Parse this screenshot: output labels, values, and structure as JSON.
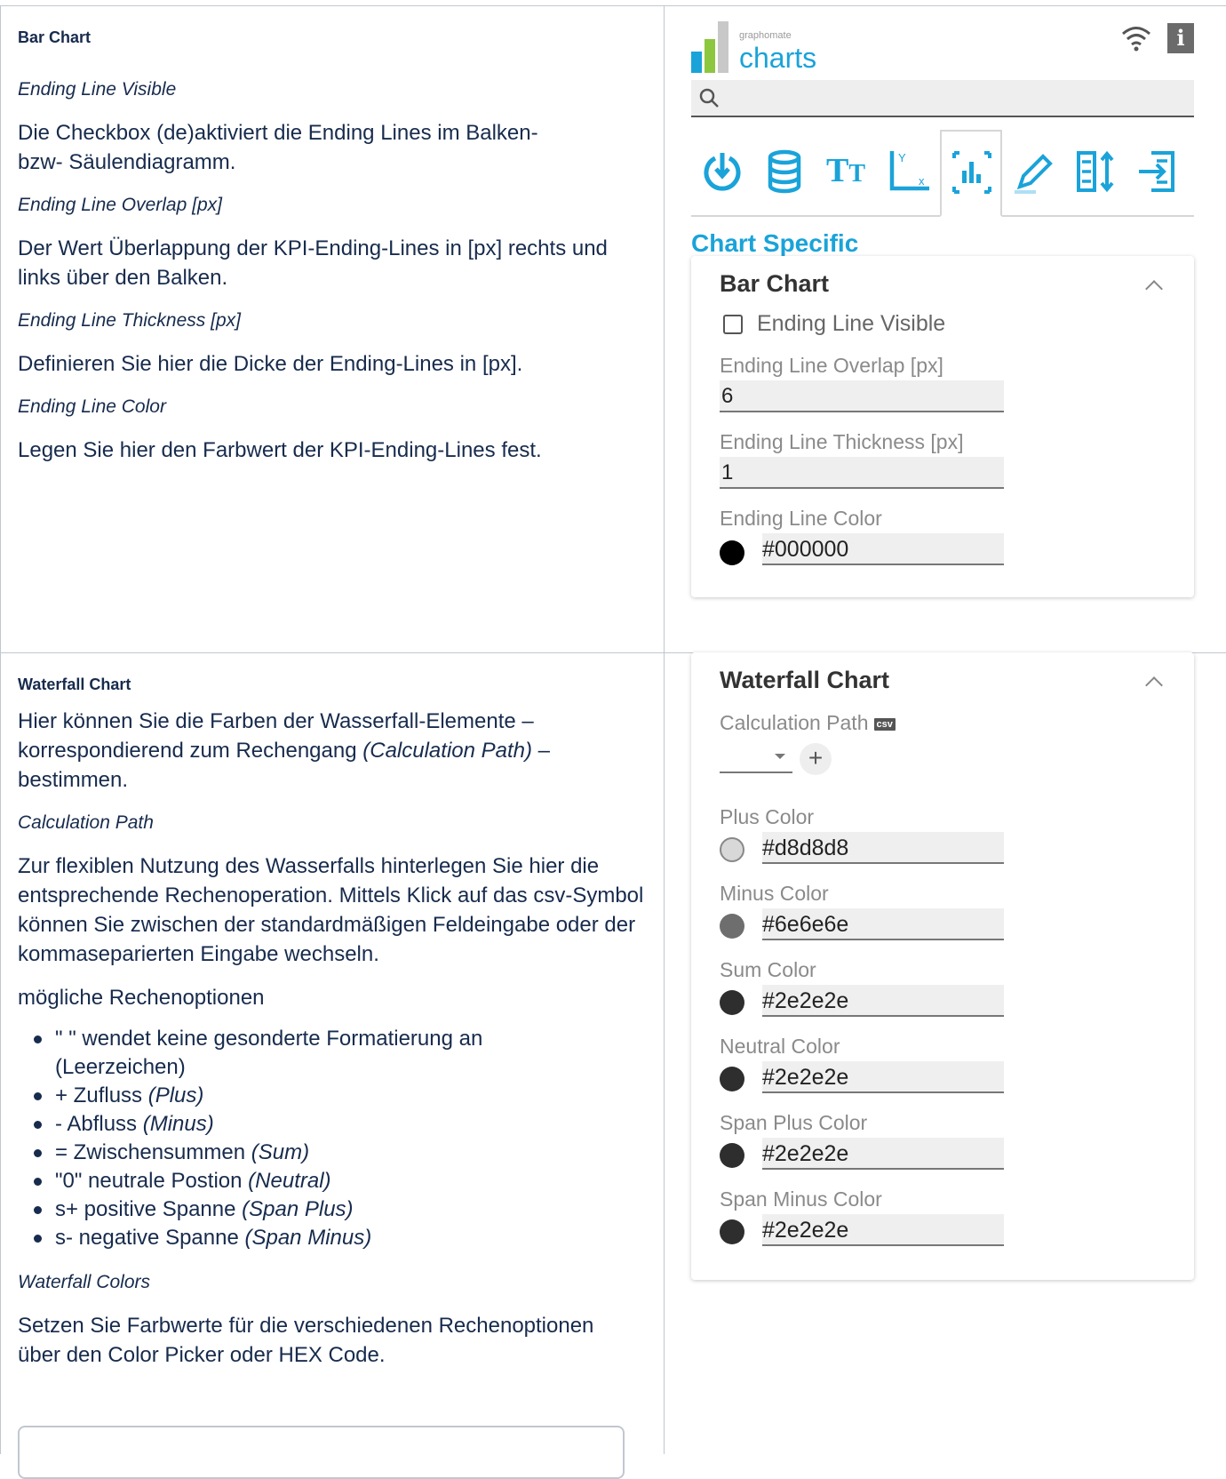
{
  "bar": {
    "heading": "Bar Chart",
    "items": [
      {
        "sub": "Ending Line Visible",
        "text": "Die Checkbox (de)aktiviert die Ending Lines im Balken- bzw- Säulendiagramm."
      },
      {
        "sub": "Ending Line Overlap [px]",
        "text": "Der Wert Überlappung der KPI-Ending-Lines in [px] rechts und links über den Balken."
      },
      {
        "sub": "Ending Line Thickness [px]",
        "text": "Definieren Sie hier die Dicke der Ending-Lines in [px]."
      },
      {
        "sub": "Ending Line Color",
        "text": "Legen Sie hier den Farbwert der KPI-Ending-Lines fest."
      }
    ]
  },
  "waterfall": {
    "heading": "Waterfall Chart",
    "intro_a": "Hier können Sie die Farben der Wasserfall-Elemente – korrespondierend zum Rechengang ",
    "intro_italic": "(Calculation Path)",
    "intro_b": " – bestimmen.",
    "calc_sub": "Calculation Path",
    "calc_text": "Zur flexiblen Nutzung des Wasserfalls hinterlegen Sie hier die entsprechende Rechenoperation. Mittels Klick auf das csv-Symbol können Sie zwischen der standardmäßigen Feldeingabe oder der kommaseparierten Eingabe wechseln.",
    "options_title": "mögliche Rechenoptionen",
    "options": [
      {
        "text": "\" \" wendet keine gesonderte Formatierung an (Leerzeichen)",
        "italic": ""
      },
      {
        "text": "+ Zufluss ",
        "italic": "(Plus)"
      },
      {
        "text": "- Abfluss ",
        "italic": "(Minus)"
      },
      {
        "text": "= Zwischensummen ",
        "italic": "(Sum)"
      },
      {
        "text": "\"0\" neutrale Postion ",
        "italic": "(Neutral)"
      },
      {
        "text": "s+ positive Spanne ",
        "italic": "(Span Plus)"
      },
      {
        "text": "s- negative Spanne ",
        "italic": "(Span Minus)"
      }
    ],
    "colors_sub": "Waterfall Colors",
    "colors_text": "Setzen Sie Farbwerte für die verschiedenen Rechenoptionen über den Color Picker oder HEX Code."
  },
  "panel": {
    "logo_small": "graphomate",
    "logo_big": "charts",
    "info_label": "i",
    "section_title": "Chart Specific",
    "bar_card": {
      "title": "Bar Chart",
      "checkbox_label": "Ending Line Visible",
      "overlap_label": "Ending Line Overlap [px]",
      "overlap_value": "6",
      "thickness_label": "Ending Line Thickness [px]",
      "thickness_value": "1",
      "color_label": "Ending Line Color",
      "color_value": "#000000"
    },
    "waterfall_card": {
      "title": "Waterfall Chart",
      "calc_label": "Calculation Path",
      "csv_label": "csv",
      "plus_btn": "+",
      "colors": [
        {
          "label": "Plus Color",
          "value": "#d8d8d8",
          "swatch": "#d8d8d8"
        },
        {
          "label": "Minus Color",
          "value": "#6e6e6e",
          "swatch": "#6e6e6e"
        },
        {
          "label": "Sum Color",
          "value": "#2e2e2e",
          "swatch": "#2e2e2e"
        },
        {
          "label": "Neutral Color",
          "value": "#2e2e2e",
          "swatch": "#2e2e2e"
        },
        {
          "label": "Span Plus Color",
          "value": "#2e2e2e",
          "swatch": "#2e2e2e"
        },
        {
          "label": "Span Minus Color",
          "value": "#2e2e2e",
          "swatch": "#2e2e2e"
        }
      ]
    },
    "icons": [
      "power-icon",
      "database-icon",
      "text-size-icon",
      "axis-icon",
      "bar-chart-icon",
      "pencil-icon",
      "sort-icon",
      "import-icon"
    ],
    "accent": "#1aa3d9"
  }
}
